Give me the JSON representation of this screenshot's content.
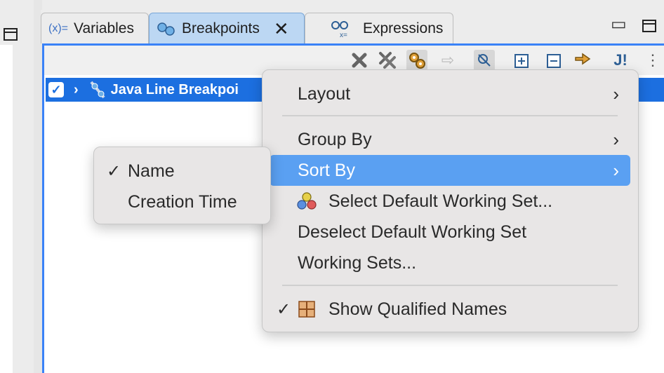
{
  "tabs": [
    {
      "label": "Variables",
      "icon": "variables-icon",
      "active": false
    },
    {
      "label": "Breakpoints",
      "icon": "breakpoints-icon",
      "active": true
    },
    {
      "label": "Expressions",
      "icon": "expressions-icon",
      "active": false
    }
  ],
  "tab_close_glyph": "✕",
  "tree": {
    "row_label": "Java Line Breakpoi",
    "checked": true,
    "expander": "›"
  },
  "context_menu": {
    "items": [
      {
        "label": "Layout",
        "has_submenu": true
      },
      {
        "label": "Group By",
        "has_submenu": true
      },
      {
        "label": "Sort By",
        "has_submenu": true,
        "highlighted": true
      },
      {
        "label": "Select Default Working Set...",
        "icon": "working-set-icon"
      },
      {
        "label": "Deselect Default Working Set"
      },
      {
        "label": "Working Sets..."
      },
      {
        "label": "Show Qualified Names",
        "icon": "qualified-names-icon",
        "checked": true
      }
    ],
    "arrow_glyph": "›",
    "check_glyph": "✓"
  },
  "sort_submenu": {
    "items": [
      {
        "label": "Name",
        "checked": true
      },
      {
        "label": "Creation Time",
        "checked": false
      }
    ]
  },
  "colors": {
    "accent": "#3a82f7",
    "selection": "#1c6fe0",
    "menu_highlight": "#5aa0f2"
  }
}
